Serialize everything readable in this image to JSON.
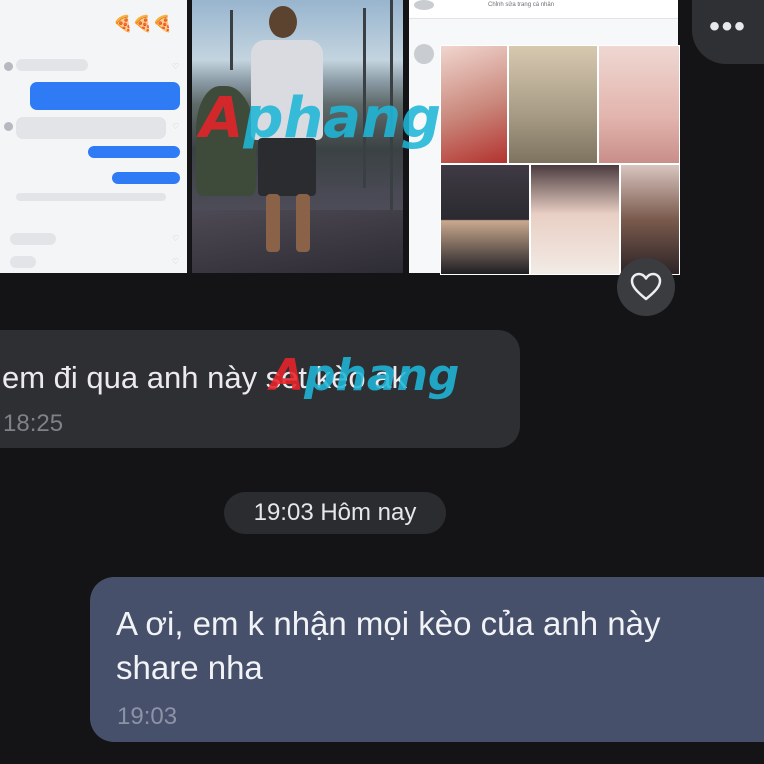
{
  "shared_images": {
    "chat_screenshot": {
      "emoji_row": "🍕🍕🍕",
      "label": "chat-screenshot"
    },
    "person_photo": {
      "label": "person-photo"
    },
    "profile_grid": {
      "header_text": "Chỉnh sửa trang cá nhân",
      "label": "profile-grid"
    }
  },
  "watermarks": [
    {
      "first": "A",
      "rest": "phang"
    },
    {
      "first": "A",
      "rest": "phang"
    }
  ],
  "more_button": {
    "icon": "more-dots-icon",
    "glyph": "•••"
  },
  "reaction": {
    "icon": "heart-outline-icon"
  },
  "messages": [
    {
      "direction": "received",
      "text": "em đi qua anh này set kèo ak",
      "time": "18:25"
    },
    {
      "direction": "sent",
      "text": "A ơi, em k nhận mọi kèo của anh này share nha",
      "time": "19:03"
    }
  ],
  "date_separator": "19:03 Hôm nay",
  "colors": {
    "background": "#141416",
    "received_bubble": "#2e2f33",
    "sent_bubble": "#46506a",
    "watermark_red": "#e8242a",
    "watermark_cyan": "#1fb7d8"
  }
}
